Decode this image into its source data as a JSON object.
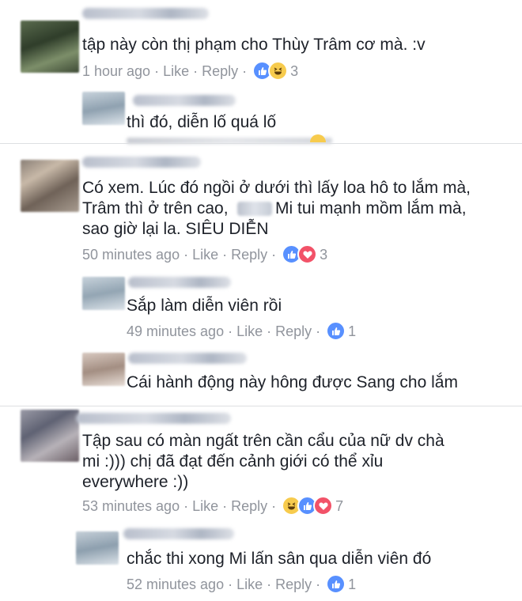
{
  "colors": {
    "like": "#5890ff",
    "love": "#f25268",
    "haha": "#f7cb4d",
    "meta": "#90949c",
    "text": "#1d2129"
  },
  "comments": [
    {
      "text": "tập này còn thị phạm cho Thùy Trâm cơ mà. :v",
      "time": "1 hour ago",
      "like": "Like",
      "reply": "Reply",
      "reactions": [
        "haha-icon",
        "like-icon"
      ],
      "count": "3"
    },
    {
      "text": "thì đó, diễn lố quá lố"
    },
    {
      "text1": "Có xem. Lúc đó ngồi ở dưới thì lấy loa hô to lắm mà,",
      "text2a": "Trâm thì ở trên cao,",
      "text2b": "Mi tui mạnh mồm lắm mà,",
      "text3": "sao giờ lại la. SIÊU DIỄN",
      "time": "50 minutes ago",
      "like": "Like",
      "reply": "Reply",
      "count": "3"
    },
    {
      "text": "Sắp làm diễn viên rồi",
      "time": "49 minutes ago",
      "like": "Like",
      "reply": "Reply",
      "count": "1"
    },
    {
      "text": "Cái hành động này hông được Sang cho lắm"
    },
    {
      "text1": "Tập sau có màn ngất trên cần cẩu của nữ dv chà",
      "text2": "mi :))) chị đã đạt đến cảnh giới có thể xỉu",
      "text3": "everywhere :))",
      "time": "53 minutes ago",
      "like": "Like",
      "reply": "Reply",
      "count": "7"
    },
    {
      "text": "chắc thi xong Mi lấn sân qua diễn viên đó",
      "time": "52 minutes ago",
      "like": "Like",
      "reply": "Reply",
      "count": "1"
    }
  ],
  "separator": "·"
}
